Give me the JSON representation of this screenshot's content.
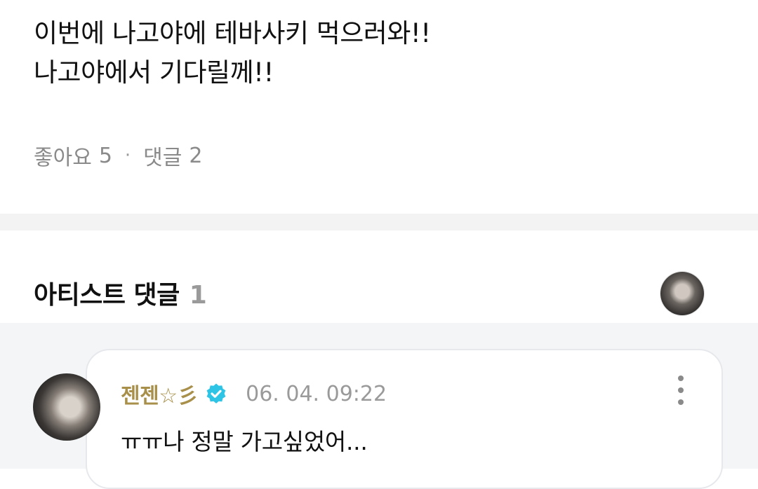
{
  "post": {
    "lines": [
      "이번에 나고야에 테바사키 먹으러와!!",
      "나고야에서 기다릴께!!"
    ],
    "likes_label": "좋아요",
    "likes_count": "5",
    "separator": "·",
    "comments_label": "댓글",
    "comments_count": "2"
  },
  "artist_comments": {
    "title": "아티스트 댓글",
    "count": "1",
    "items": [
      {
        "author": "젠젠☆彡",
        "verified": true,
        "time": "06. 04. 09:22",
        "text": "ㅠㅠ나 정말 가고싶었어..."
      }
    ]
  },
  "colors": {
    "author_gold": "#a88f4a",
    "verified_blue": "#2ec4e6",
    "muted_text": "#8a8a8a",
    "divider": "#f3f3f3"
  },
  "icons": [
    "verified-check-icon",
    "more-vertical-icon"
  ]
}
